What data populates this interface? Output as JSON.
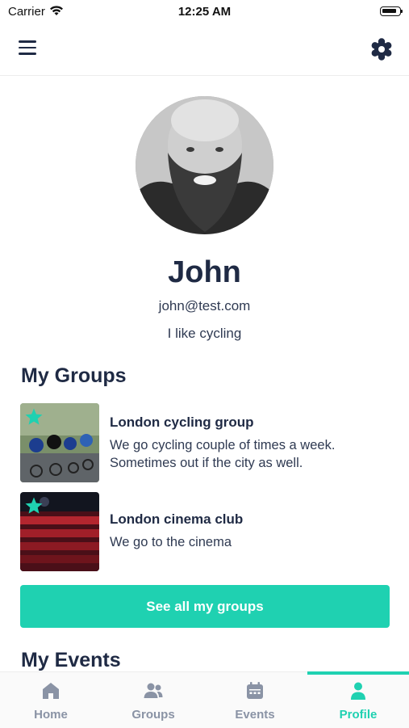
{
  "status_bar": {
    "carrier": "Carrier",
    "time": "12:25 AM"
  },
  "profile": {
    "name": "John",
    "email": "john@test.com",
    "bio": "I like cycling"
  },
  "groups_section": {
    "title": "My Groups",
    "items": [
      {
        "title": "London cycling group",
        "description": "We go cycling couple of times a week. Sometimes out if the city as well."
      },
      {
        "title": "London cinema club",
        "description": "We go to the cinema"
      }
    ],
    "see_all_label": "See all my groups"
  },
  "events_section": {
    "title": "My Events"
  },
  "tabs": [
    {
      "label": "Home",
      "icon": "home-icon"
    },
    {
      "label": "Groups",
      "icon": "people-icon"
    },
    {
      "label": "Events",
      "icon": "calendar-icon"
    },
    {
      "label": "Profile",
      "icon": "person-icon",
      "active": true
    }
  ],
  "colors": {
    "accent": "#1fd1b1",
    "text_primary": "#1f2a44",
    "tab_inactive": "#8a93a5"
  }
}
